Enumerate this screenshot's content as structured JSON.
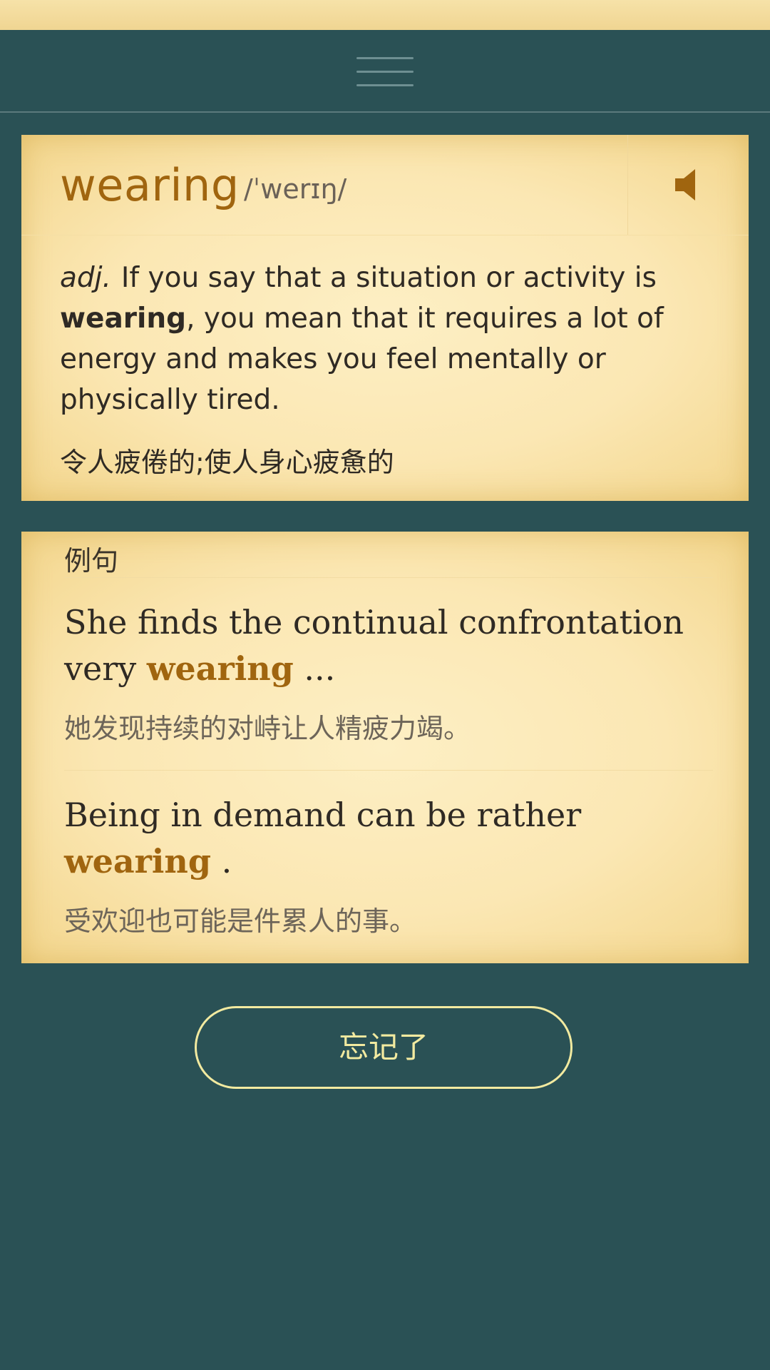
{
  "top_strip": {
    "text": ""
  },
  "header": {
    "menu_icon": "hamburger-menu-icon"
  },
  "word_card": {
    "word": "wearing",
    "phonetic": "/ˈwerɪŋ/",
    "speaker_icon": "speaker-icon",
    "definition": {
      "pos": "adj.",
      "text_before": "If you say that a situation or activity is ",
      "highlight": "wearing",
      "text_after": ", you mean that it requires a lot of energy and makes you feel mentally or physically tired."
    },
    "definition_cn": "令人疲倦的;使人身心疲惫的"
  },
  "examples_card": {
    "heading": "例句",
    "examples": [
      {
        "en_before": "She finds the continual confrontation very ",
        "en_highlight": "wearing",
        "en_after": " ...",
        "cn": "她发现持续的对峙让人精疲力竭。"
      },
      {
        "en_before": "Being in demand can be rather ",
        "en_highlight": "wearing",
        "en_after": " .",
        "cn": "受欢迎也可能是件累人的事。"
      }
    ]
  },
  "actions": {
    "forgot_label": "忘记了"
  },
  "colors": {
    "background": "#2a5155",
    "accent_word": "#a0650f",
    "button_outline": "#f2eaa0"
  }
}
